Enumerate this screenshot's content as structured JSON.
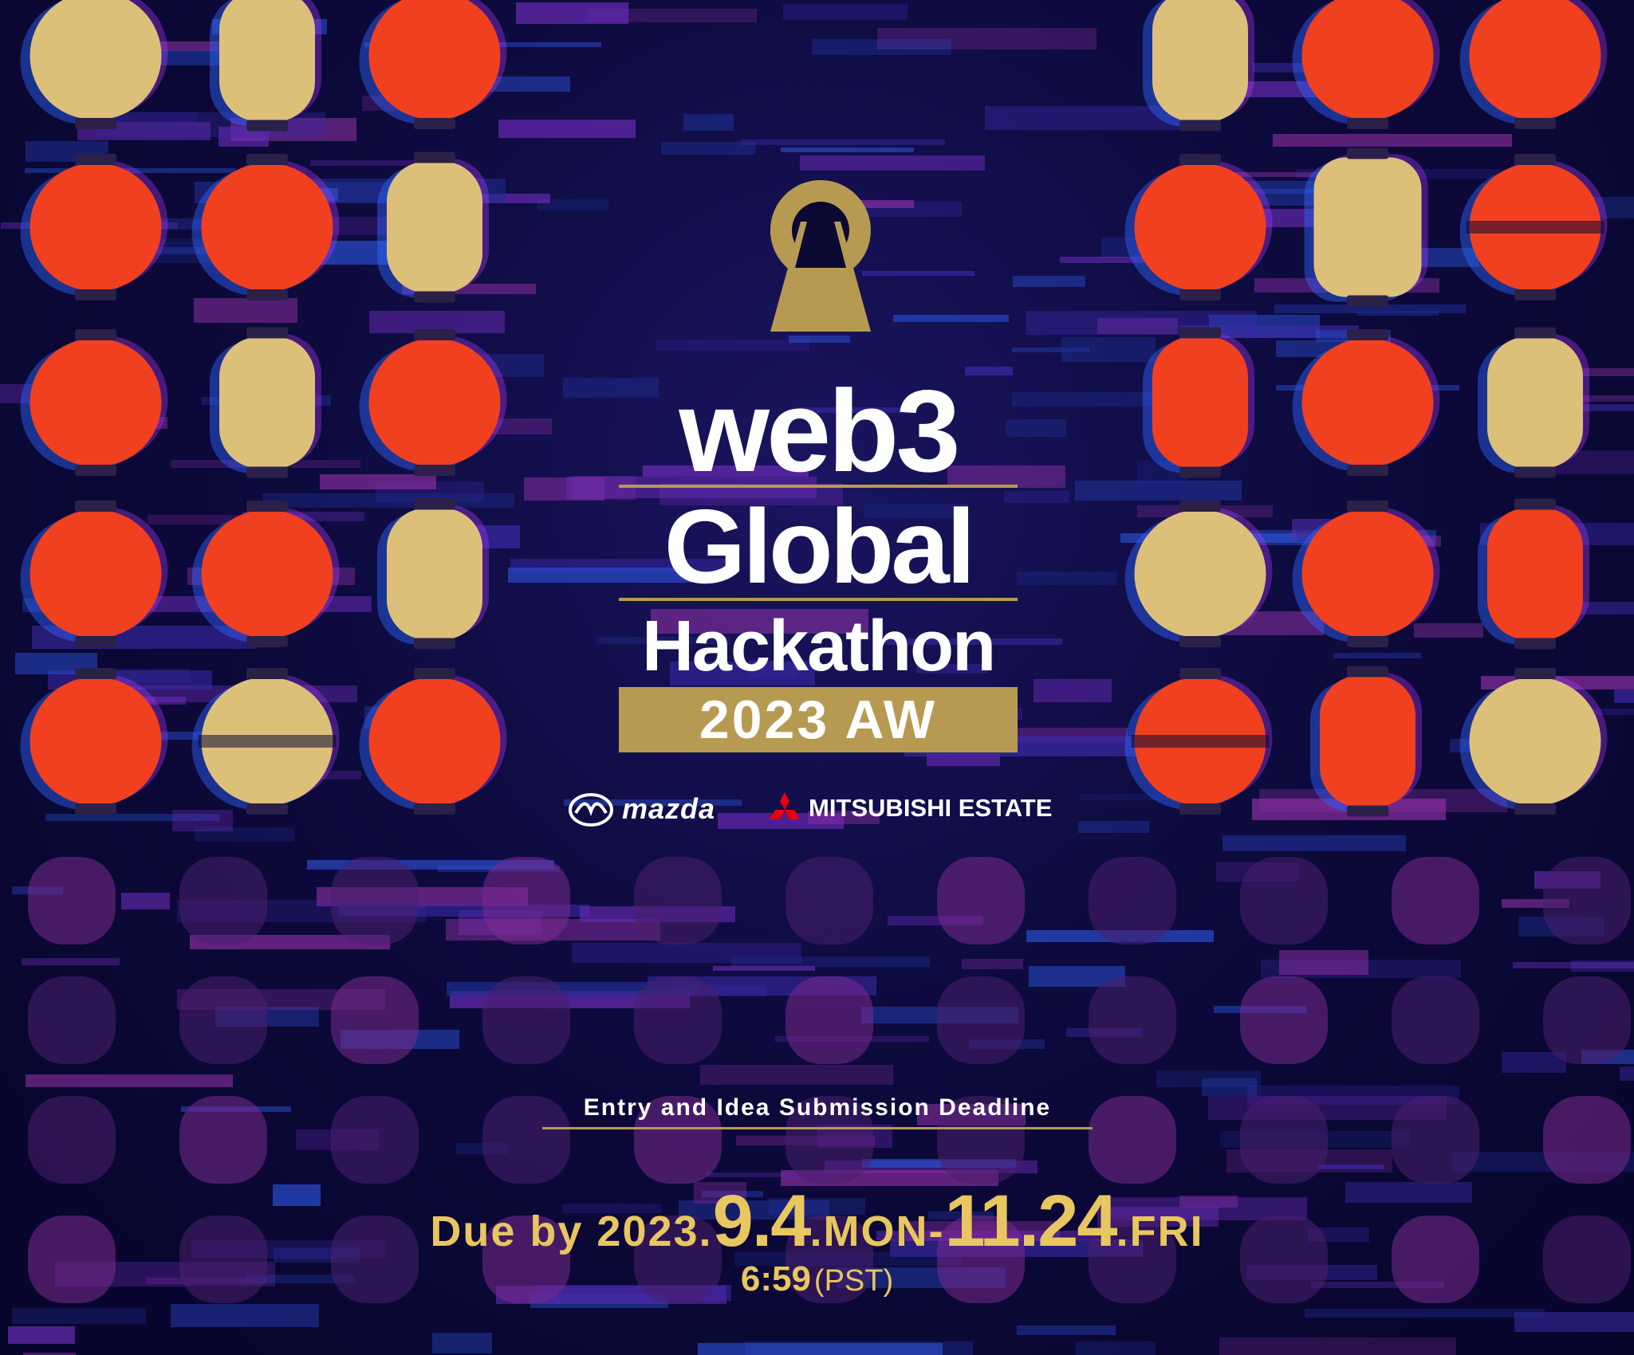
{
  "title": {
    "line1": "web3",
    "line2": "Global",
    "line3": "Hackathon",
    "edition": "2023 AW"
  },
  "sponsors": {
    "mazda": "mazda",
    "mitsubishi": "MITSUBISHI ESTATE"
  },
  "deadline": {
    "label": "Entry and Idea Submission Deadline",
    "prefix": "Due by 2023.",
    "start_date": "9.4",
    "start_day": ".MON-",
    "end_date": "11.24",
    "end_day": ".FRI",
    "time": "6:59",
    "timezone": "(PST)"
  },
  "colors": {
    "background": "#0b0832",
    "gold": "#b79a52",
    "deadline_text": "#e8c660",
    "lantern_red": "#f0401f",
    "lantern_gold": "#dcc07a"
  },
  "icons": {
    "logo_mark": "keyhole-logo-icon",
    "mazda": "mazda-emblem-icon",
    "mitsubishi": "three-diamonds-icon"
  }
}
